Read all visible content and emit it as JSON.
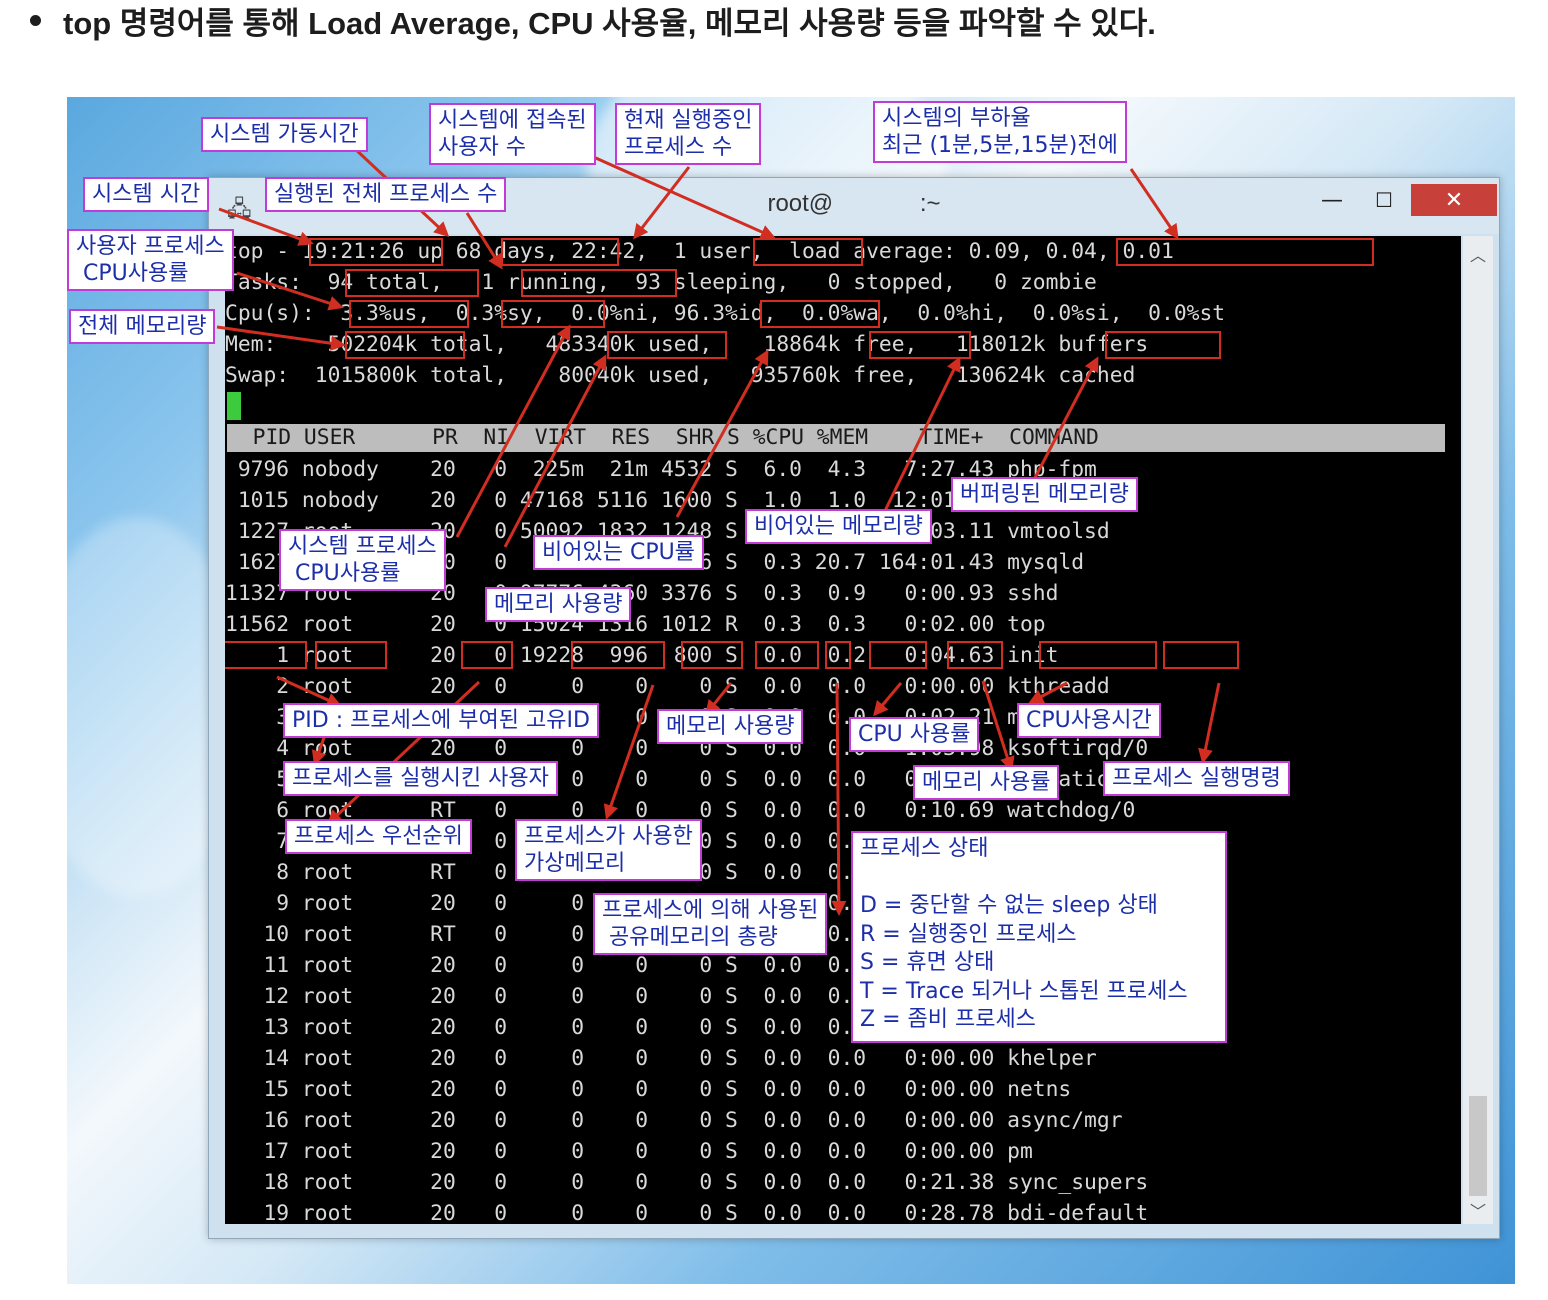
{
  "heading": {
    "text": "top 명령어를 통해 Load Average, CPU 사용율, 메모리 사용량 등을 파악할 수 있다."
  },
  "window": {
    "title_user": "root@",
    "title_path": ":~",
    "minimize_glyph": "—",
    "maximize_glyph": "☐",
    "close_glyph": "✕",
    "app_icon": "putty-icon"
  },
  "terminal": {
    "summary": [
      "top - 19:21:26 up 68 days, 22:42,  1 user,  load average: 0.09, 0.04, 0.01",
      "Tasks:  94 total,   1 running,  93 sleeping,   0 stopped,   0 zombie",
      "Cpu(s):  3.3%us,  0.3%sy,  0.0%ni, 96.3%id,  0.0%wa,  0.0%hi,  0.0%si,  0.0%st",
      "Mem:    502204k total,   483340k used,    18864k free,   118012k buffers",
      "Swap:  1015800k total,    80040k used,   935760k free,   130624k cached"
    ],
    "header": "  PID USER      PR  NI  VIRT  RES  SHR S %CPU %MEM    TIME+  COMMAND",
    "processes": [
      " 9796 nobody    20   0  225m  21m 4532 S  6.0  4.3   7:27.43 php-fpm",
      " 1015 nobody    20   0 47168 5116 1600 S  1.0  1.0  12:01.11 nginx",
      " 1227 root      20   0 50092 1832 1248 S  0.3  0.4  73:03.11 vmtoolsd",
      " 1627 mysql     20   0  468m 101m 3816 S  0.3 20.7 164:01.43 mysqld",
      "11327 root      20   0 97776 4360 3376 S  0.3  0.9   0:00.93 sshd",
      "11562 root      20   0 15024 1316 1012 R  0.3  0.3   0:02.00 top",
      "    1 root      20   0 19228  996  800 S  0.0  0.2   0:04.63 init",
      "    2 root      20   0     0    0    0 S  0.0  0.0   0:00.00 kthreadd",
      "    3 root      RT   0     0    0    0 S  0.0  0.0   0:02.21 migration/0",
      "    4 root      20   0     0    0    0 S  0.0  0.0   1:03.98 ksoftirqd/0",
      "    5 root      RT   0     0    0    0 S  0.0  0.0   0:00.00 migration/0",
      "    6 root      RT   0     0    0    0 S  0.0  0.0   0:10.69 watchdog/0",
      "    7 root      RT   0     0    0    0 S  0.0  0.0   0:02.03 migration/1",
      "    8 root      RT   0     0    0    0 S  0.0  0.0   0:00.00 migration/1",
      "    9 root      20   0     0    0    0 S  0.0  0.0   0:59.31 ksoftirqd/1",
      "   10 root      RT   0     0    0    0 S  0.0  0.0   0:09.41 watchdog/1",
      "   11 root      20   0     0    0    0 S  0.0  0.0   0:19.34 events/0",
      "   12 root      20   0     0    0    0 S  0.0  0.0   0:21.07 events/1",
      "   13 root      20   0     0    0    0 S  0.0  0.0   0:00.00 cgroup",
      "   14 root      20   0     0    0    0 S  0.0  0.0   0:00.00 khelper",
      "   15 root      20   0     0    0    0 S  0.0  0.0   0:00.00 netns",
      "   16 root      20   0     0    0    0 S  0.0  0.0   0:00.00 async/mgr",
      "   17 root      20   0     0    0    0 S  0.0  0.0   0:00.00 pm",
      "   18 root      20   0     0    0    0 S  0.0  0.0   0:21.38 sync_supers",
      "   19 root      20   0     0    0    0 S  0.0  0.0   0:28.78 bdi-default"
    ]
  },
  "callouts": {
    "system_time": "시스템 시간",
    "uptime": "시스템 가동시간",
    "users_connected": "시스템에 접속된\n사용자 수",
    "running_procs": "현재 실행중인\n프로세스 수",
    "load": "시스템의 부하율\n최근 (1분,5분,15분)전에",
    "total_procs": "실행된 전체 프로세스 수",
    "user_cpu": "사용자 프로세스\n CPU사용률",
    "total_mem": "전체 메모리량",
    "sys_cpu": "시스템 프로세스\n CPU사용률",
    "idle_cpu": "비어있는 CPU률",
    "mem_used": "메모리 사용량",
    "free_mem": "비어있는 메모리량",
    "buffer_mem": "버퍼링된 메모리량",
    "pid": "PID : 프로세스에 부여된 고유ID",
    "user": "프로세스를 실행시킨 사용자",
    "priority": "프로세스 우선순위",
    "virt": "프로세스가 사용한\n가상메모리",
    "res": "메모리 사용량",
    "shr": "프로세스에 의해 사용된\n 공유메모리의 총량",
    "cpu_pct": "CPU 사용률",
    "mem_pct": "메모리 사용률",
    "cpu_time": "CPU사용시간",
    "command": "프로세스 실행명령",
    "state": "프로세스 상태\n\nD = 중단할 수 없는 sleep 상태\nR = 실행중인 프로세스\nS = 휴면 상태\nT = Trace 되거나 스톱된 프로세스\nZ = 좀비 프로세스"
  },
  "colors": {
    "terminal_bg": "#000000",
    "terminal_fg": "#d9d9d9",
    "highlight_border": "#d12d20",
    "callout_border": "#c23bd6",
    "callout_text": "#1d2fa8",
    "close_button": "#c7403a"
  }
}
